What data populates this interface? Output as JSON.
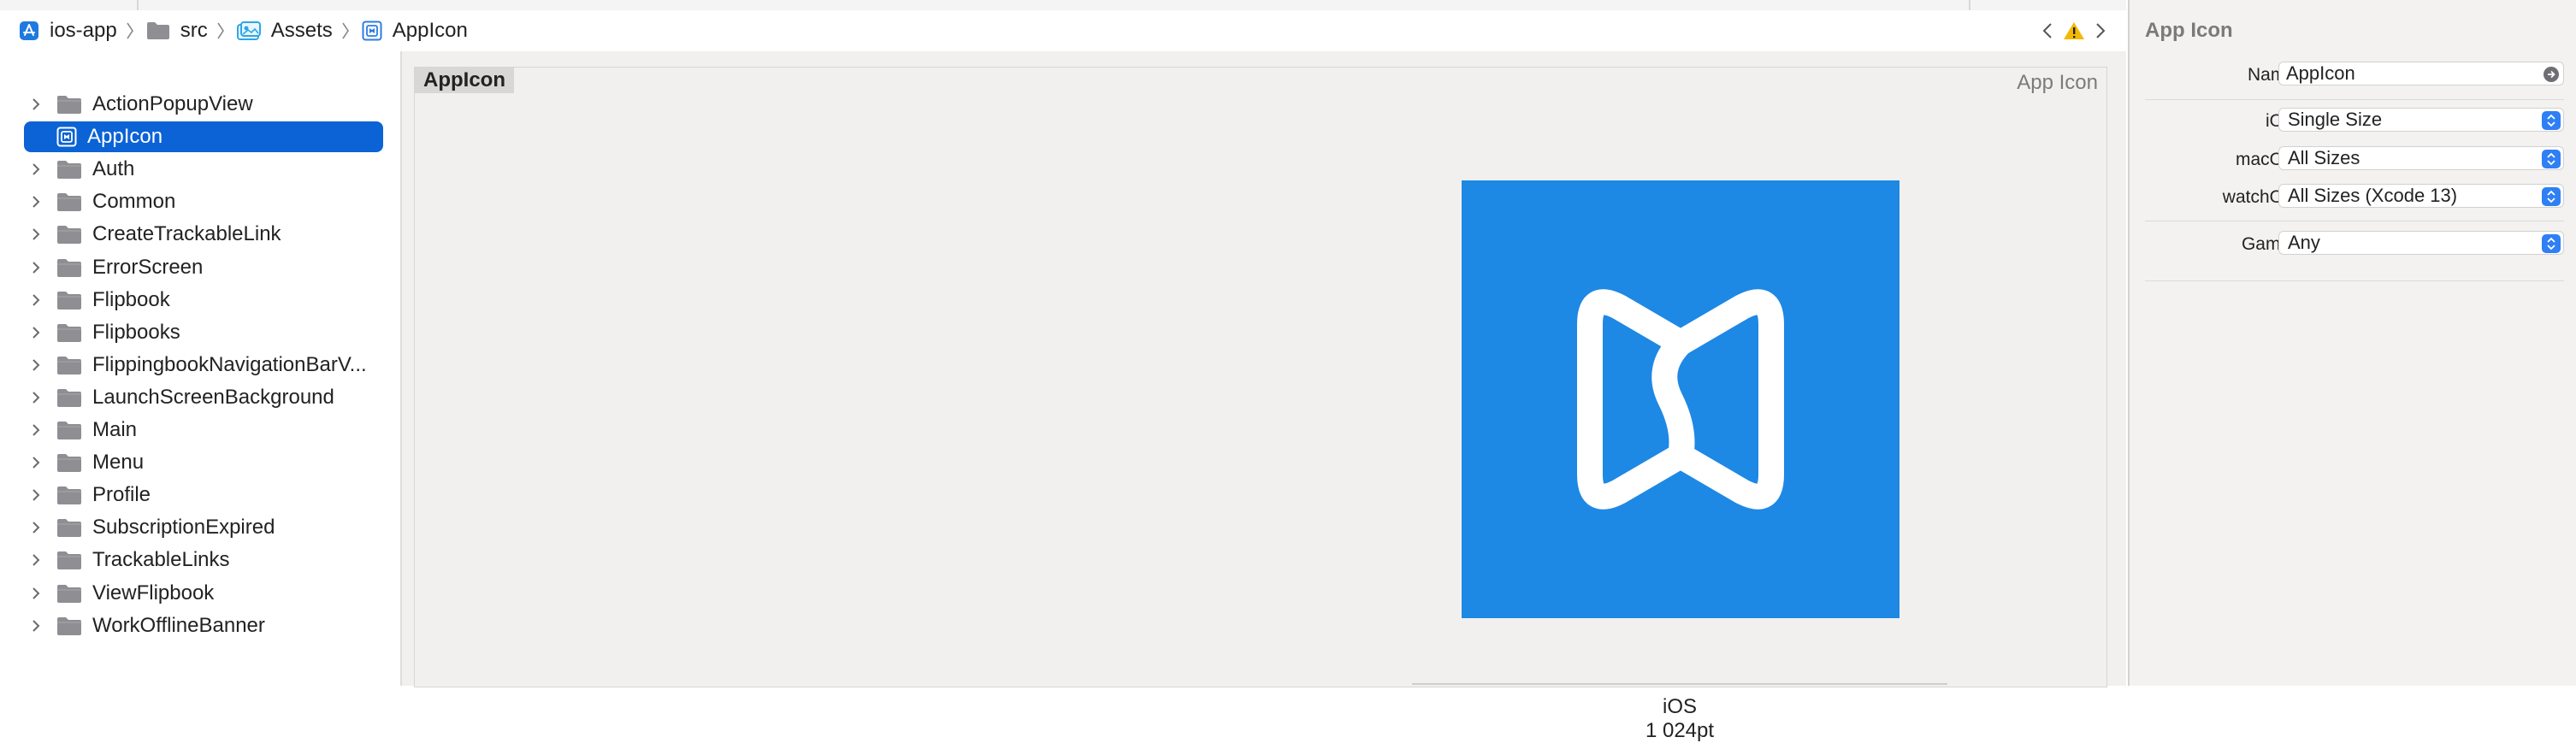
{
  "breadcrumb": {
    "items": [
      {
        "label": "ios-app",
        "icon": "app-store-icon"
      },
      {
        "label": "src",
        "icon": "folder-icon"
      },
      {
        "label": "Assets",
        "icon": "asset-catalog-icon"
      },
      {
        "label": "AppIcon",
        "icon": "app-icon-set-icon"
      }
    ]
  },
  "navigator": {
    "items": [
      {
        "label": "ActionPopupView"
      },
      {
        "label": "AppIcon"
      },
      {
        "label": "Auth"
      },
      {
        "label": "Common"
      },
      {
        "label": "CreateTrackableLink"
      },
      {
        "label": "ErrorScreen"
      },
      {
        "label": "Flipbook"
      },
      {
        "label": "Flipbooks"
      },
      {
        "label": "FlippingbookNavigationBarV..."
      },
      {
        "label": "LaunchScreenBackground"
      },
      {
        "label": "Main"
      },
      {
        "label": "Menu"
      },
      {
        "label": "Profile"
      },
      {
        "label": "SubscriptionExpired"
      },
      {
        "label": "TrackableLinks"
      },
      {
        "label": "ViewFlipbook"
      },
      {
        "label": "WorkOfflineBanner"
      }
    ]
  },
  "editor": {
    "set_title": "AppIcon",
    "set_type": "App Icon",
    "platform": "iOS",
    "size": "1 024pt",
    "icon_color": "#1e88e5"
  },
  "inspector": {
    "title": "App Icon",
    "name_label": "Name",
    "name_value": "AppIcon",
    "ios_label": "iOS",
    "ios_value": "Single Size",
    "macos_label": "macOS",
    "macos_value": "All Sizes",
    "watchos_label": "watchOS",
    "watchos_value": "All Sizes (Xcode 13)",
    "gamut_label": "Gamut",
    "gamut_value": "Any"
  },
  "colors": {
    "selection": "#0b63d6",
    "accent": "#2f7ff5",
    "warning": "#f5b800"
  }
}
